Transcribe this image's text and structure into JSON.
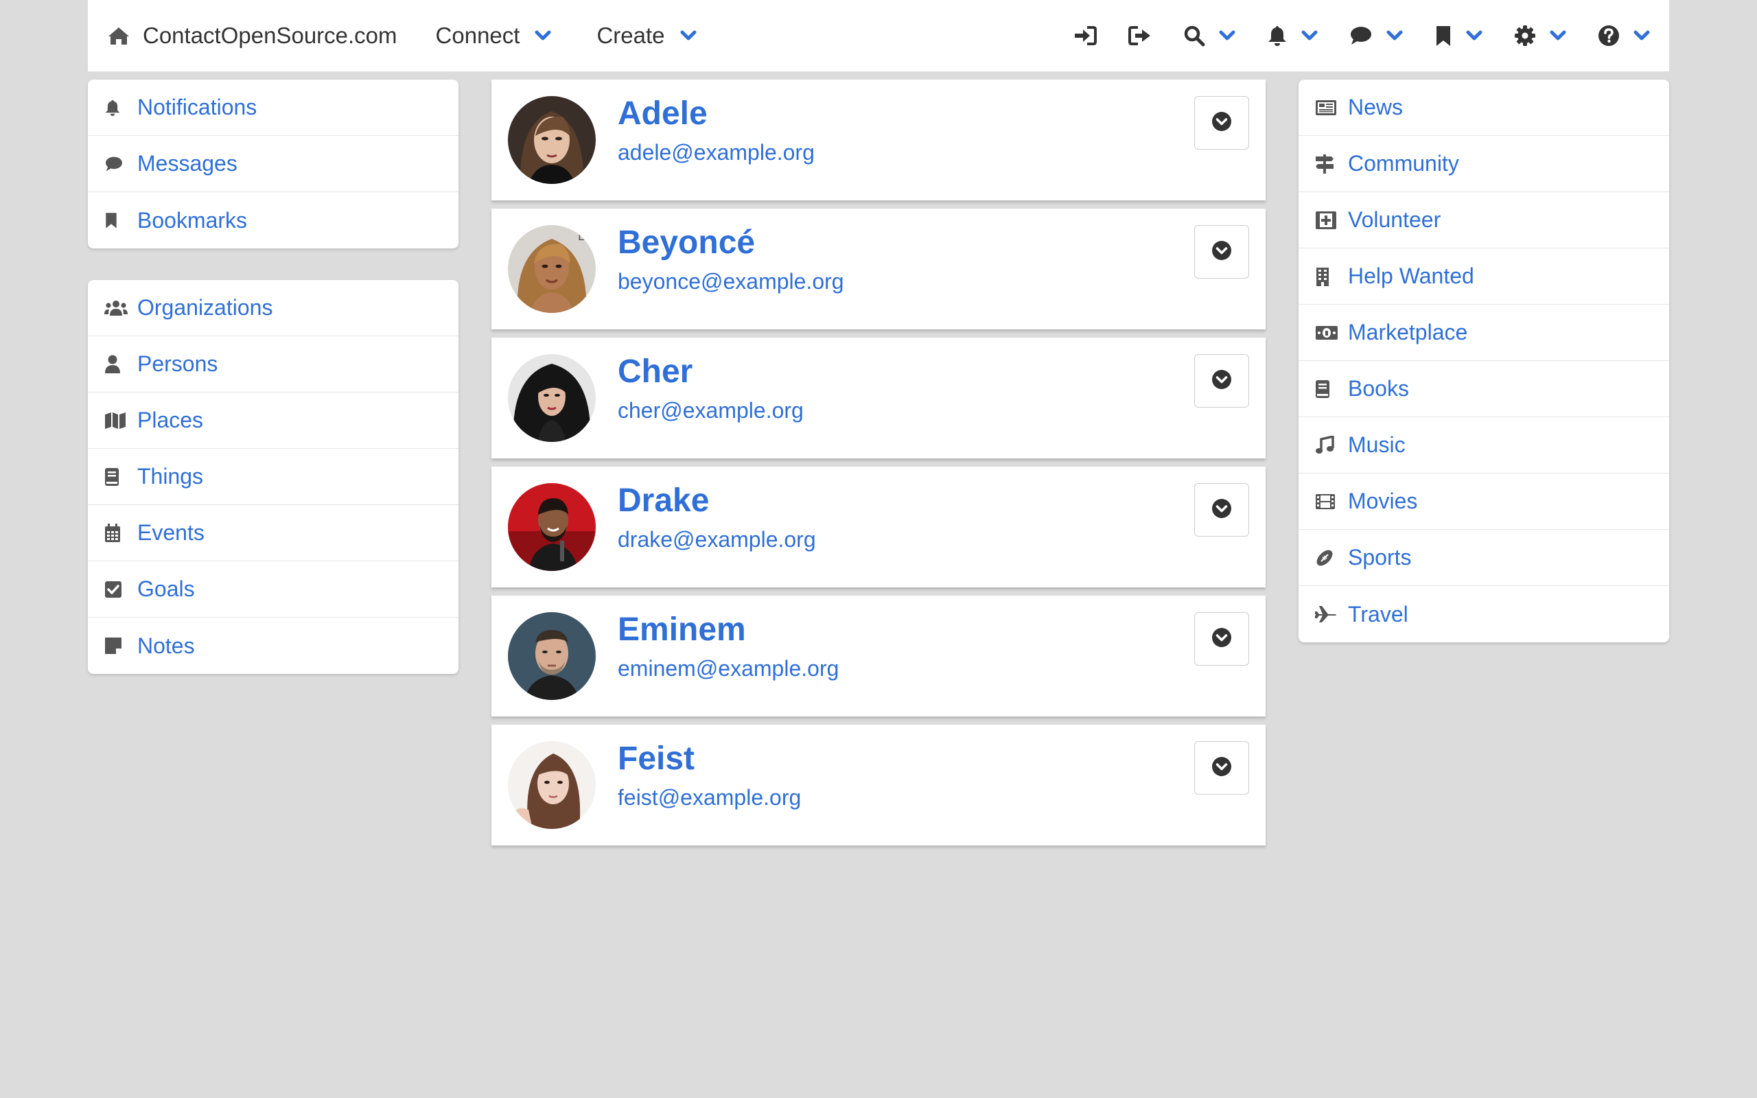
{
  "navbar": {
    "brand": "ContactOpenSource.com",
    "menus": [
      {
        "label": "Connect"
      },
      {
        "label": "Create"
      }
    ],
    "icons": [
      "sign-in-icon",
      "sign-out-icon",
      "search-icon",
      "bell-icon",
      "comment-icon",
      "bookmark-icon",
      "gear-icon",
      "question-circle-icon"
    ]
  },
  "left_top": {
    "items": [
      {
        "label": "Notifications",
        "icon": "bell-icon"
      },
      {
        "label": "Messages",
        "icon": "comment-icon"
      },
      {
        "label": "Bookmarks",
        "icon": "bookmark-icon"
      }
    ]
  },
  "left_bottom": {
    "items": [
      {
        "label": "Organizations",
        "icon": "users-icon"
      },
      {
        "label": "Persons",
        "icon": "user-icon"
      },
      {
        "label": "Places",
        "icon": "map-icon"
      },
      {
        "label": "Things",
        "icon": "book-icon"
      },
      {
        "label": "Events",
        "icon": "calendar-icon"
      },
      {
        "label": "Goals",
        "icon": "check-square-icon"
      },
      {
        "label": "Notes",
        "icon": "sticky-note-icon"
      }
    ]
  },
  "right": {
    "items": [
      {
        "label": "News",
        "icon": "newspaper-icon"
      },
      {
        "label": "Community",
        "icon": "signs-icon"
      },
      {
        "label": "Volunteer",
        "icon": "first-aid-icon"
      },
      {
        "label": "Help Wanted",
        "icon": "building-icon"
      },
      {
        "label": "Marketplace",
        "icon": "money-bill-icon"
      },
      {
        "label": "Books",
        "icon": "book-icon"
      },
      {
        "label": "Music",
        "icon": "music-icon"
      },
      {
        "label": "Movies",
        "icon": "film-icon"
      },
      {
        "label": "Sports",
        "icon": "football-icon"
      },
      {
        "label": "Travel",
        "icon": "plane-icon"
      }
    ]
  },
  "people": [
    {
      "name": "Adele",
      "email": "adele@example.org"
    },
    {
      "name": "Beyoncé",
      "email": "beyonce@example.org"
    },
    {
      "name": "Cher",
      "email": "cher@example.org"
    },
    {
      "name": "Drake",
      "email": "drake@example.org"
    },
    {
      "name": "Eminem",
      "email": "eminem@example.org"
    },
    {
      "name": "Feist",
      "email": "feist@example.org"
    }
  ],
  "colors": {
    "accent": "#2f6fd6",
    "icon": "#555555",
    "background": "#dcdcdc"
  }
}
